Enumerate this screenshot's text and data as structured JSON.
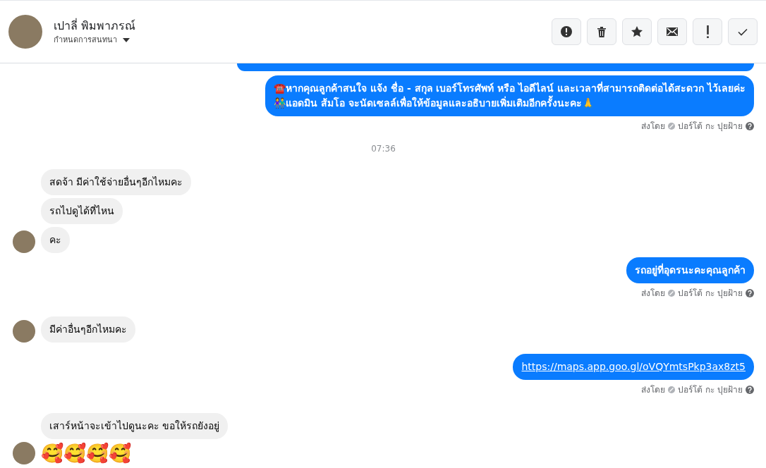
{
  "header": {
    "name": "เปาลี่ พิมพาภรณ์",
    "subtitle": "กำหนดการสนทนา",
    "actions": [
      {
        "kind": "alert"
      },
      {
        "kind": "trash"
      },
      {
        "kind": "star"
      },
      {
        "kind": "mail"
      },
      {
        "kind": "exclaim"
      },
      {
        "kind": "check"
      }
    ]
  },
  "messages": [
    {
      "kind": "clipped"
    },
    {
      "kind": "outgoing",
      "lines": [
        "☎️หากคุณลูกค้าสนใจ แจ้ง ชื่อ - สกุล เบอร์โทรศัพท์ หรือ ไอดีไลน์ และเวลาที่สามารถติดต่อได้สะดวก ไว้เลยค่ะ",
        "👫แอดมิน ส้มโอ จะนัดเซลล์เพื่อให้ข้อมูลและอธิบายเพิ่มเติมอีกครั้งนะคะ🙏"
      ],
      "sent_by": "ส่งโดย",
      "sender": "ปอร์โต้ กะ ปุยฝ้าย"
    },
    {
      "kind": "time",
      "text": "07:36"
    },
    {
      "kind": "incoming",
      "text": "สดจ้า มีค่าใช้จ่ายอื่นๆอีกไหมคะ",
      "avatar": false
    },
    {
      "kind": "incoming",
      "text": "รถไปดูได้ที่ไหน",
      "avatar": false
    },
    {
      "kind": "incoming",
      "text": "คะ",
      "avatar": true
    },
    {
      "kind": "outgoing",
      "lines": [
        "รถอยู่ที่อุดรนะคะคุณลูกค้า"
      ],
      "sent_by": "ส่งโดย",
      "sender": "ปอร์โต้ กะ ปุยฝ้าย"
    },
    {
      "kind": "incoming",
      "text": "มีค่าอื่นๆอีกไหมคะ",
      "avatar": true
    },
    {
      "kind": "link",
      "text": "https://maps.app.goo.gl/oVQYmtsPkp3ax8zt5",
      "sent_by": "ส่งโดย",
      "sender": "ปอร์โต้ กะ ปุยฝ้าย"
    },
    {
      "kind": "incoming",
      "text": "เสาร์หน้าจะเข้าไปดูนะคะ ขอให้รถยังอยู่",
      "avatar": false
    },
    {
      "kind": "emoji",
      "text": "🥰🥰🥰🥰",
      "avatar": true
    }
  ]
}
